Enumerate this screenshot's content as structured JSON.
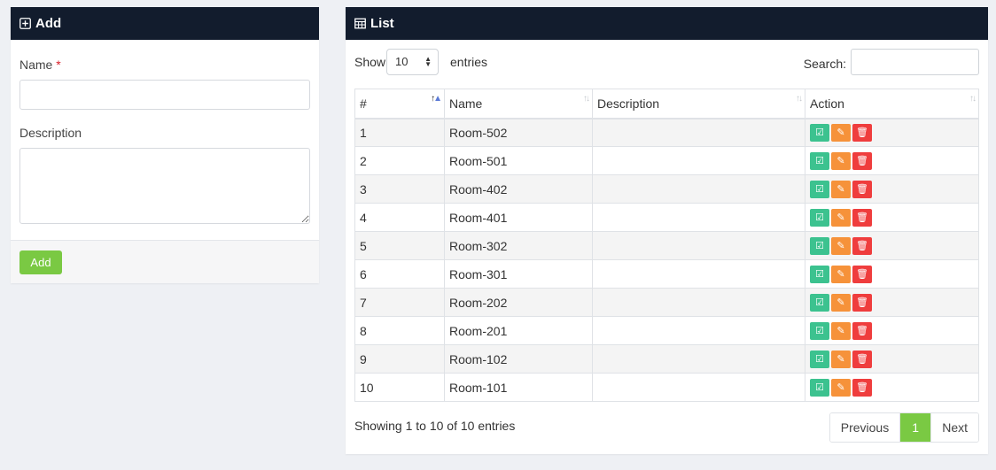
{
  "add_panel": {
    "title": "Add",
    "name_label": "Name",
    "name_required": "*",
    "name_value": "",
    "description_label": "Description",
    "description_value": "",
    "add_button": "Add"
  },
  "list_panel": {
    "title": "List",
    "show_label": "Show",
    "page_length": "10",
    "entries_label": "entries",
    "search_label": "Search:",
    "search_value": "",
    "columns": [
      "#",
      "Name",
      "Description",
      "Action"
    ],
    "rows": [
      {
        "num": "1",
        "name": "Room-502",
        "description": ""
      },
      {
        "num": "2",
        "name": "Room-501",
        "description": ""
      },
      {
        "num": "3",
        "name": "Room-402",
        "description": ""
      },
      {
        "num": "4",
        "name": "Room-401",
        "description": ""
      },
      {
        "num": "5",
        "name": "Room-302",
        "description": ""
      },
      {
        "num": "6",
        "name": "Room-301",
        "description": ""
      },
      {
        "num": "7",
        "name": "Room-202",
        "description": ""
      },
      {
        "num": "8",
        "name": "Room-201",
        "description": ""
      },
      {
        "num": "9",
        "name": "Room-102",
        "description": ""
      },
      {
        "num": "10",
        "name": "Room-101",
        "description": ""
      }
    ],
    "row_actions": [
      "check-icon",
      "edit-icon",
      "trash-icon"
    ],
    "info": "Showing 1 to 10 of 10 entries",
    "pagination": {
      "previous": "Previous",
      "current": "1",
      "next": "Next"
    }
  },
  "colors": {
    "header_bg": "#121c2d",
    "accent_green": "#7ac943",
    "action_check": "#3cc28f",
    "action_edit": "#f6923a",
    "action_delete": "#ef3d3d"
  }
}
